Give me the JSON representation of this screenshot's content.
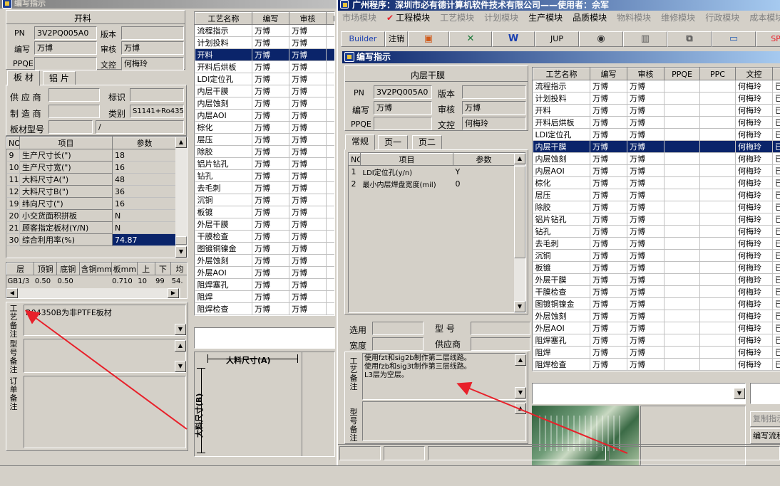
{
  "left_window": {
    "title": "编写指示",
    "section_title": "开料",
    "pn_label": "PN",
    "pn_value": "3V2PQ005A0",
    "version_label": "版本",
    "version_value": "",
    "writer_label": "编写",
    "writer_value": "万博",
    "review_label": "审核",
    "review_value": "万博",
    "ppqe_label": "PPQE",
    "ppqe_value": "",
    "doc_label": "文控",
    "doc_value": "何梅玲",
    "tabs": [
      "板 材",
      "铝 片"
    ],
    "supplier_label": "供 应 商",
    "mark_label": "标识",
    "maker_label": "制 造 商",
    "category_label": "类别",
    "category_value": "S1141+Ro435",
    "board_type_label": "板材型号",
    "board_type_value": "/",
    "param_headers": [
      "NO",
      "项目",
      "参数"
    ],
    "params": [
      {
        "no": "9",
        "item": "生产尺寸长(\")",
        "val": "18"
      },
      {
        "no": "10",
        "item": "生产尺寸宽(\")",
        "val": "16"
      },
      {
        "no": "11",
        "item": "大料尺寸A(\")",
        "val": "48"
      },
      {
        "no": "12",
        "item": "大料尺寸B(\")",
        "val": "36"
      },
      {
        "no": "19",
        "item": "纬向尺寸(\")",
        "val": "16"
      },
      {
        "no": "20",
        "item": "小交货面积拼板",
        "val": "N"
      },
      {
        "no": "21",
        "item": "顾客指定板材(Y/N)",
        "val": "N"
      },
      {
        "no": "30",
        "item": "综合利用率(%)",
        "val": "74.87"
      }
    ],
    "layer_headers": [
      "层",
      "顶铜",
      "底铜",
      "含铜mm",
      "板mm",
      "上",
      "下",
      "均"
    ],
    "layer_row": [
      "GB1/3",
      "0.50",
      "0.50",
      "",
      "0.710",
      "10",
      "99",
      "54."
    ],
    "remark_labels": [
      "工艺备注",
      "型号备注",
      "订单备注"
    ],
    "remark_text": "R04350B为非PTFE板材",
    "process_headers": [
      "工艺名称",
      "编写",
      "审核",
      "P"
    ],
    "processes": [
      [
        "流程指示",
        "万博",
        "万博"
      ],
      [
        "计划投料",
        "万博",
        "万博"
      ],
      [
        "开料",
        "万博",
        "万博"
      ],
      [
        "开料后烘板",
        "万博",
        "万博"
      ],
      [
        "LDI定位孔",
        "万博",
        "万博"
      ],
      [
        "内层干膜",
        "万博",
        "万博"
      ],
      [
        "内层蚀刻",
        "万博",
        "万博"
      ],
      [
        "内层AOI",
        "万博",
        "万博"
      ],
      [
        "棕化",
        "万博",
        "万博"
      ],
      [
        "层压",
        "万博",
        "万博"
      ],
      [
        "除胶",
        "万博",
        "万博"
      ],
      [
        "铝片钻孔",
        "万博",
        "万博"
      ],
      [
        "钻孔",
        "万博",
        "万博"
      ],
      [
        "去毛刺",
        "万博",
        "万博"
      ],
      [
        "沉铜",
        "万博",
        "万博"
      ],
      [
        "板镀",
        "万博",
        "万博"
      ],
      [
        "外层干膜",
        "万博",
        "万博"
      ],
      [
        "干膜检查",
        "万博",
        "万博"
      ],
      [
        "图镀铜镍金",
        "万博",
        "万博"
      ],
      [
        "外层蚀刻",
        "万博",
        "万博"
      ],
      [
        "外层AOI",
        "万博",
        "万博"
      ],
      [
        "阻焊塞孔",
        "万博",
        "万博"
      ],
      [
        "阻焊",
        "万博",
        "万博"
      ],
      [
        "阻焊检查",
        "万博",
        "万博"
      ]
    ],
    "dim_a_label": "大料尺寸(A)",
    "dim_b_label": "大料尺寸(B)"
  },
  "main_window": {
    "title": "广州程序：深圳市必有德计算机软件技术有限公司——使用者：佘军",
    "menu": [
      "市场模块",
      "工程模块",
      "工艺模块",
      "计划模块",
      "生产模块",
      "品质模块",
      "物料模块",
      "维修模块",
      "行政模块",
      "成本模块"
    ],
    "toolbar": [
      "Builder",
      "注销",
      "",
      "",
      "",
      "JUP",
      "",
      "",
      "",
      "",
      "SP"
    ],
    "inner_title": "编写指示",
    "section_title": "内层干膜",
    "pn_label": "PN",
    "pn_value": "3V2PQ005A0",
    "version_label": "版本",
    "version_value": "",
    "writer_label": "编写",
    "writer_value": "万博",
    "review_label": "审核",
    "review_value": "万博",
    "ppqe_label": "PPQE",
    "ppqe_value": "",
    "doc_label": "文控",
    "doc_value": "何梅玲",
    "tabs": [
      "常规",
      "页一",
      "页二"
    ],
    "param_headers": [
      "NO",
      "项目",
      "参数"
    ],
    "params": [
      {
        "no": "1",
        "item": "LDI定位孔(y/n)",
        "val": "Y"
      },
      {
        "no": "2",
        "item": "最小内层焊盘宽度(mil)",
        "val": "0"
      }
    ],
    "select_label": "选用",
    "model_label": "型 号",
    "width_label": "宽度",
    "supplier_label": "供应商",
    "remark_labels": [
      "工艺备注",
      "型号备注"
    ],
    "remark_lines": [
      "使用fzt和sig2b制作第二层线路。",
      "使用fzb和sig3t制作第三层线路。",
      "L3层为空层。"
    ],
    "process_headers": [
      "工艺名称",
      "编写",
      "审核",
      "PPQE",
      "PPC",
      "文控",
      "状"
    ],
    "processes": [
      [
        "流程指示",
        "万博",
        "万博",
        "",
        "",
        "何梅玲",
        "已"
      ],
      [
        "计划投料",
        "万博",
        "万博",
        "",
        "",
        "何梅玲",
        "已"
      ],
      [
        "开料",
        "万博",
        "万博",
        "",
        "",
        "何梅玲",
        "已"
      ],
      [
        "开料后烘板",
        "万博",
        "万博",
        "",
        "",
        "何梅玲",
        "已"
      ],
      [
        "LDI定位孔",
        "万博",
        "万博",
        "",
        "",
        "何梅玲",
        "已"
      ],
      [
        "内层干膜",
        "万博",
        "万博",
        "",
        "",
        "何梅玲",
        "已"
      ],
      [
        "内层蚀刻",
        "万博",
        "万博",
        "",
        "",
        "何梅玲",
        "已"
      ],
      [
        "内层AOI",
        "万博",
        "万博",
        "",
        "",
        "何梅玲",
        "已"
      ],
      [
        "棕化",
        "万博",
        "万博",
        "",
        "",
        "何梅玲",
        "已"
      ],
      [
        "层压",
        "万博",
        "万博",
        "",
        "",
        "何梅玲",
        "已"
      ],
      [
        "除胶",
        "万博",
        "万博",
        "",
        "",
        "何梅玲",
        "已"
      ],
      [
        "铝片钻孔",
        "万博",
        "万博",
        "",
        "",
        "何梅玲",
        "已"
      ],
      [
        "钻孔",
        "万博",
        "万博",
        "",
        "",
        "何梅玲",
        "已"
      ],
      [
        "去毛刺",
        "万博",
        "万博",
        "",
        "",
        "何梅玲",
        "已"
      ],
      [
        "沉铜",
        "万博",
        "万博",
        "",
        "",
        "何梅玲",
        "已"
      ],
      [
        "板镀",
        "万博",
        "万博",
        "",
        "",
        "何梅玲",
        "已"
      ],
      [
        "外层干膜",
        "万博",
        "万博",
        "",
        "",
        "何梅玲",
        "已"
      ],
      [
        "干膜检查",
        "万博",
        "万博",
        "",
        "",
        "何梅玲",
        "已"
      ],
      [
        "图镀铜镍金",
        "万博",
        "万博",
        "",
        "",
        "何梅玲",
        "已"
      ],
      [
        "外层蚀刻",
        "万博",
        "万博",
        "",
        "",
        "何梅玲",
        "已"
      ],
      [
        "外层AOI",
        "万博",
        "万博",
        "",
        "",
        "何梅玲",
        "已"
      ],
      [
        "阻焊塞孔",
        "万博",
        "万博",
        "",
        "",
        "何梅玲",
        "已"
      ],
      [
        "阻焊",
        "万博",
        "万博",
        "",
        "",
        "何梅玲",
        "已"
      ],
      [
        "阻焊检查",
        "万博",
        "万博",
        "",
        "",
        "何梅玲",
        "已"
      ]
    ],
    "copy_button": "复制指示",
    "write_button": "编写流程"
  },
  "colors": {
    "selection": "#0a246a",
    "annotation_arrow": "#e8202a",
    "menu_check": "#e8202a"
  }
}
